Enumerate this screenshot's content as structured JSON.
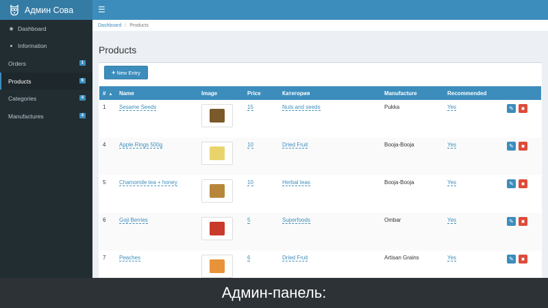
{
  "app": {
    "brand_title": "Админ Сова"
  },
  "sidebar": {
    "items": [
      {
        "label": "Dashboard",
        "icon": "dashboard-icon",
        "badge": ""
      },
      {
        "label": "Information",
        "icon": "info-icon",
        "badge": ""
      },
      {
        "label": "Orders",
        "icon": "",
        "badge": "1"
      },
      {
        "label": "Products",
        "icon": "",
        "badge": "6"
      },
      {
        "label": "Categories",
        "icon": "",
        "badge": "4"
      },
      {
        "label": "Manufactures",
        "icon": "",
        "badge": "4"
      }
    ]
  },
  "breadcrumb": {
    "home": "Dashboard",
    "current": "Products"
  },
  "page": {
    "title": "Products"
  },
  "toolbar": {
    "new_entry_label": "New Entry"
  },
  "table": {
    "columns": [
      "#",
      "Name",
      "Image",
      "Price",
      "Категория",
      "Manufacture",
      "Recommended"
    ],
    "rows": [
      {
        "id": "1",
        "name": "Sesame Seeds",
        "price": "15",
        "category": "Nuts and seeds",
        "manufacture": "Pukka",
        "recommended": "Yes",
        "image_color": "#7a5a2a"
      },
      {
        "id": "4",
        "name": "Apple Rings 500g",
        "price": "10",
        "category": "Dried Fruit",
        "manufacture": "Booja-Booja",
        "recommended": "Yes",
        "image_color": "#e8d46a"
      },
      {
        "id": "5",
        "name": "Chamomile tea + honey",
        "price": "10",
        "category": "Herbal teas",
        "manufacture": "Booja-Booja",
        "recommended": "Yes",
        "image_color": "#b8863a"
      },
      {
        "id": "6",
        "name": "Goji Berries",
        "price": "5",
        "category": "Superfoods",
        "manufacture": "Ombar",
        "recommended": "Yes",
        "image_color": "#c83a2a"
      },
      {
        "id": "7",
        "name": "Peaches",
        "price": "6",
        "category": "Dried Fruit",
        "manufacture": "Artisan Grains",
        "recommended": "Yes",
        "image_color": "#e8923a"
      }
    ]
  },
  "caption": {
    "text": "Админ-панель:"
  },
  "colors": {
    "primary": "#3c8dbc",
    "sidebar_bg": "#222d32",
    "danger": "#dd4b39"
  }
}
